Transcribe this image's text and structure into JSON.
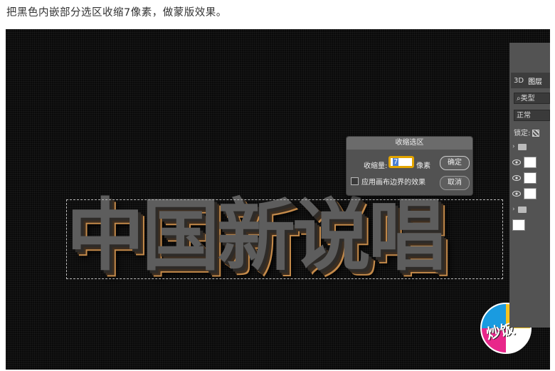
{
  "caption": "把黑色内嵌部分选区收缩7像素，做蒙版效果。",
  "dialog": {
    "title": "收缩选区",
    "amount_label": "收缩量:",
    "amount_value": "7",
    "unit": "像素",
    "ok_label": "确定",
    "cancel_label": "取消",
    "checkbox_label": "应用画布边界的效果",
    "checkbox_checked": false
  },
  "panel": {
    "tabs": [
      "3D",
      "图层"
    ],
    "search_placeholder": "类型",
    "blend_mode": "正常",
    "lock_label": "锁定:"
  },
  "artwork": {
    "text": "中国新说唱"
  },
  "logo": {
    "text": "炒饭"
  },
  "colors": {
    "canvas_bg": "#0a0a0a",
    "dialog_bg": "#525252",
    "input_focus": "#e2a400",
    "text_face": "#5d5d5d",
    "text_edge": "#c48a4a"
  }
}
